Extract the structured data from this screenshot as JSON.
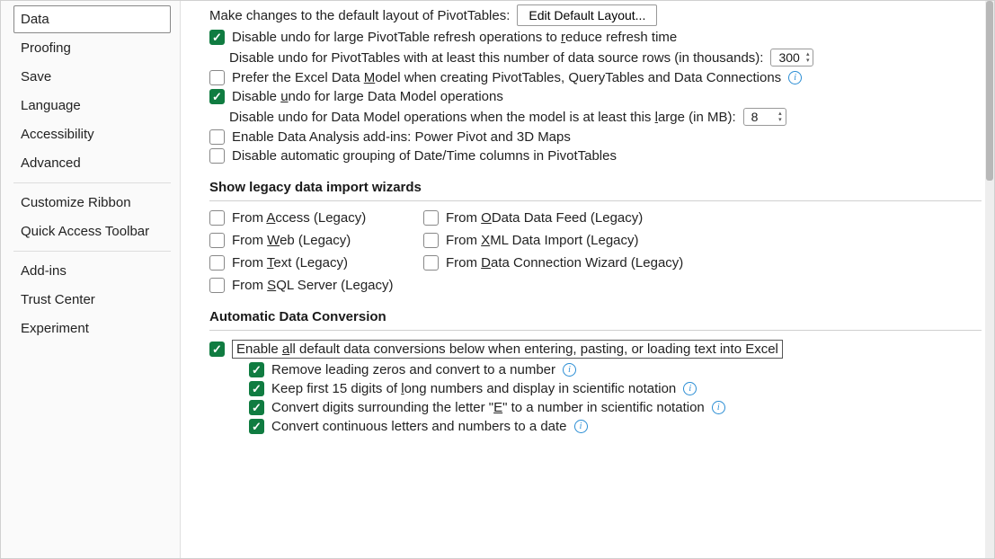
{
  "sidebar": {
    "items": [
      {
        "label": "Data",
        "selected": true
      },
      {
        "label": "Proofing"
      },
      {
        "label": "Save"
      },
      {
        "label": "Language"
      },
      {
        "label": "Accessibility"
      },
      {
        "label": "Advanced"
      }
    ],
    "items2": [
      {
        "label": "Customize Ribbon"
      },
      {
        "label": "Quick Access Toolbar"
      }
    ],
    "items3": [
      {
        "label": "Add-ins"
      },
      {
        "label": "Trust Center"
      },
      {
        "label": "Experiment"
      }
    ]
  },
  "pivot": {
    "intro": "Make changes to the default layout of PivotTables:",
    "editBtn": "Edit Default Layout...",
    "disableUndoRefresh": {
      "checked": true,
      "label_pre": "Disable undo for large PivotTable refresh operations to ",
      "label_u": "r",
      "label_post": "educe refresh time"
    },
    "disableUndoRows": {
      "label": "Disable undo for PivotTables with at least this number of data source rows (in thousands):",
      "value": "300"
    },
    "preferModel": {
      "checked": false,
      "label_pre": "Prefer the Excel Data ",
      "label_u": "M",
      "label_post": "odel when creating PivotTables, QueryTables and Data Connections"
    },
    "disableUndoDM": {
      "checked": true,
      "label_pre": "Disable ",
      "label_u": "u",
      "label_post": "ndo for large Data Model operations"
    },
    "disableUndoDMsize": {
      "label_pre": "Disable undo for Data Model operations when the model is at least this ",
      "label_u": "l",
      "label_post": "arge (in MB):",
      "value": "8"
    },
    "enableAddins": {
      "checked": false,
      "label": "Enable Data Analysis add-ins: Power Pivot and 3D Maps"
    },
    "disableGrouping": {
      "checked": false,
      "label": "Disable automatic grouping of Date/Time columns in PivotTables"
    }
  },
  "legacy": {
    "title": "Show legacy data import wizards",
    "items": [
      {
        "pre": "From ",
        "u": "A",
        "post": "ccess (Legacy)"
      },
      {
        "pre": "From ",
        "u": "O",
        "post": "Data Data Feed (Legacy)"
      },
      {
        "pre": "From ",
        "u": "W",
        "post": "eb (Legacy)"
      },
      {
        "pre": "From ",
        "u": "X",
        "post": "ML Data Import (Legacy)"
      },
      {
        "pre": "From ",
        "u": "T",
        "post": "ext (Legacy)"
      },
      {
        "pre": "From ",
        "u": "D",
        "post": "ata Connection Wizard (Legacy)"
      },
      {
        "pre": "From ",
        "u": "S",
        "post": "QL Server (Legacy)"
      }
    ]
  },
  "conversion": {
    "title": "Automatic Data Conversion",
    "enableAll": {
      "checked": true,
      "label_pre": "Enable ",
      "label_u": "a",
      "label_post": "ll default data conversions below when entering, pasting, or loading text into Excel"
    },
    "subs": [
      {
        "checked": true,
        "label": "Remove leading zeros and convert to a number",
        "info": true
      },
      {
        "checked": true,
        "pre": "Keep first 15 digits of ",
        "u": "l",
        "post": "ong numbers and display in scientific notation",
        "info": true
      },
      {
        "checked": true,
        "pre": "Convert digits surrounding the letter \"",
        "u": "E",
        "post": "\" to a number in scientific notation",
        "info": true
      },
      {
        "checked": true,
        "label": "Convert continuous letters and numbers to a date",
        "info": true
      }
    ]
  }
}
